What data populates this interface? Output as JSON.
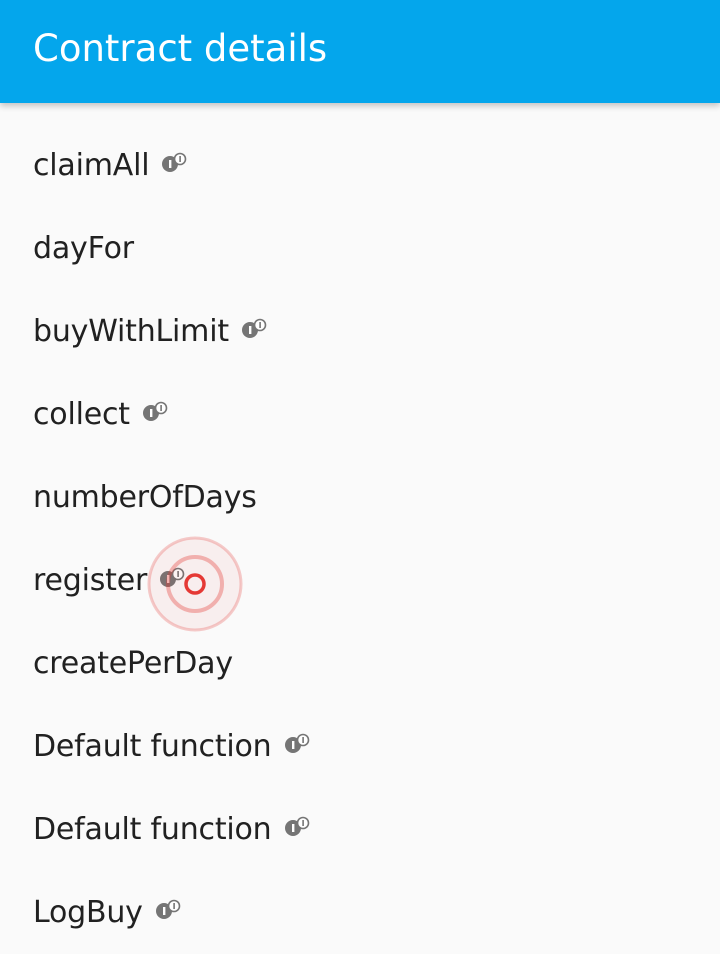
{
  "header": {
    "title": "Contract details"
  },
  "functions": [
    {
      "label": "claimAll",
      "has_info_icon": true,
      "info_icon": "info-badge-icon"
    },
    {
      "label": "dayFor",
      "has_info_icon": false
    },
    {
      "label": "buyWithLimit",
      "has_info_icon": true,
      "info_icon": "info-badge-icon"
    },
    {
      "label": "collect",
      "has_info_icon": true,
      "info_icon": "info-badge-icon"
    },
    {
      "label": "numberOfDays",
      "has_info_icon": false
    },
    {
      "label": "register",
      "has_info_icon": true,
      "info_icon": "info-badge-icon"
    },
    {
      "label": "createPerDay",
      "has_info_icon": false
    },
    {
      "label": "Default function",
      "has_info_icon": true,
      "info_icon": "info-badge-icon"
    },
    {
      "label": "Default function",
      "has_info_icon": true,
      "info_icon": "info-badge-icon"
    },
    {
      "label": "LogBuy",
      "has_info_icon": true,
      "info_icon": "info-badge-icon"
    }
  ],
  "colors": {
    "app_bar": "#04a6ec",
    "background": "#fafafa",
    "text": "#212121",
    "icon": "#757575",
    "touch_indicator": "#e53935"
  }
}
